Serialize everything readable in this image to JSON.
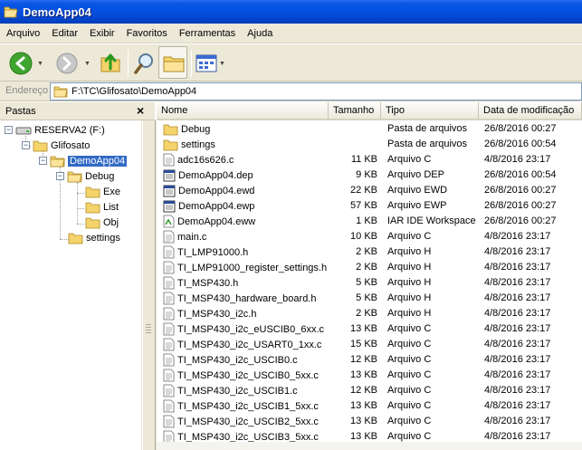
{
  "window": {
    "title": "DemoApp04"
  },
  "menu": [
    "Arquivo",
    "Editar",
    "Exibir",
    "Favoritos",
    "Ferramentas",
    "Ajuda"
  ],
  "address": {
    "label": "Endereço",
    "path": "F:\\TC\\Glifosato\\DemoApp04"
  },
  "folders_pane": {
    "title": "Pastas",
    "tree": [
      {
        "label": "RESERVA2 (F:)",
        "icon": "drive-icon"
      },
      {
        "label": "Glifosato",
        "icon": "folder-icon"
      },
      {
        "label": "DemoApp04",
        "icon": "folder-open-icon",
        "selected": true
      },
      {
        "label": "Debug",
        "icon": "folder-open-icon"
      },
      {
        "label": "Exe",
        "icon": "folder-icon"
      },
      {
        "label": "List",
        "icon": "folder-icon"
      },
      {
        "label": "Obj",
        "icon": "folder-icon"
      },
      {
        "label": "settings",
        "icon": "folder-icon"
      }
    ]
  },
  "columns": {
    "name": "Nome",
    "size": "Tamanho",
    "type": "Tipo",
    "date": "Data de modificação"
  },
  "files": [
    {
      "name": "Debug",
      "size": "",
      "type": "Pasta de arquivos",
      "date": "26/8/2016 00:27",
      "icon": "folder-icon"
    },
    {
      "name": "settings",
      "size": "",
      "type": "Pasta de arquivos",
      "date": "26/8/2016 00:54",
      "icon": "folder-icon"
    },
    {
      "name": "adc16s626.c",
      "size": "11 KB",
      "type": "Arquivo C",
      "date": "4/8/2016 23:17",
      "icon": "document-icon"
    },
    {
      "name": "DemoApp04.dep",
      "size": "9 KB",
      "type": "Arquivo DEP",
      "date": "26/8/2016 00:54",
      "icon": "window-file-icon"
    },
    {
      "name": "DemoApp04.ewd",
      "size": "22 KB",
      "type": "Arquivo EWD",
      "date": "26/8/2016 00:27",
      "icon": "window-file-icon"
    },
    {
      "name": "DemoApp04.ewp",
      "size": "57 KB",
      "type": "Arquivo EWP",
      "date": "26/8/2016 00:27",
      "icon": "window-file-icon"
    },
    {
      "name": "DemoApp04.eww",
      "size": "1 KB",
      "type": "IAR IDE Workspace",
      "date": "26/8/2016 00:27",
      "icon": "workspace-icon"
    },
    {
      "name": "main.c",
      "size": "10 KB",
      "type": "Arquivo C",
      "date": "4/8/2016 23:17",
      "icon": "document-icon"
    },
    {
      "name": "TI_LMP91000.h",
      "size": "2 KB",
      "type": "Arquivo H",
      "date": "4/8/2016 23:17",
      "icon": "document-icon"
    },
    {
      "name": "TI_LMP91000_register_settings.h",
      "size": "2 KB",
      "type": "Arquivo H",
      "date": "4/8/2016 23:17",
      "icon": "document-icon"
    },
    {
      "name": "TI_MSP430.h",
      "size": "5 KB",
      "type": "Arquivo H",
      "date": "4/8/2016 23:17",
      "icon": "document-icon"
    },
    {
      "name": "TI_MSP430_hardware_board.h",
      "size": "5 KB",
      "type": "Arquivo H",
      "date": "4/8/2016 23:17",
      "icon": "document-icon"
    },
    {
      "name": "TI_MSP430_i2c.h",
      "size": "2 KB",
      "type": "Arquivo H",
      "date": "4/8/2016 23:17",
      "icon": "document-icon"
    },
    {
      "name": "TI_MSP430_i2c_eUSCIB0_6xx.c",
      "size": "13 KB",
      "type": "Arquivo C",
      "date": "4/8/2016 23:17",
      "icon": "document-icon"
    },
    {
      "name": "TI_MSP430_i2c_USART0_1xx.c",
      "size": "15 KB",
      "type": "Arquivo C",
      "date": "4/8/2016 23:17",
      "icon": "document-icon"
    },
    {
      "name": "TI_MSP430_i2c_USCIB0.c",
      "size": "12 KB",
      "type": "Arquivo C",
      "date": "4/8/2016 23:17",
      "icon": "document-icon"
    },
    {
      "name": "TI_MSP430_i2c_USCIB0_5xx.c",
      "size": "13 KB",
      "type": "Arquivo C",
      "date": "4/8/2016 23:17",
      "icon": "document-icon"
    },
    {
      "name": "TI_MSP430_i2c_USCIB1.c",
      "size": "12 KB",
      "type": "Arquivo C",
      "date": "4/8/2016 23:17",
      "icon": "document-icon"
    },
    {
      "name": "TI_MSP430_i2c_USCIB1_5xx.c",
      "size": "13 KB",
      "type": "Arquivo C",
      "date": "4/8/2016 23:17",
      "icon": "document-icon"
    },
    {
      "name": "TI_MSP430_i2c_USCIB2_5xx.c",
      "size": "13 KB",
      "type": "Arquivo C",
      "date": "4/8/2016 23:17",
      "icon": "document-icon"
    },
    {
      "name": "TI_MSP430_i2c_USCIB3_5xx.c",
      "size": "13 KB",
      "type": "Arquivo C",
      "date": "4/8/2016 23:17",
      "icon": "document-icon"
    }
  ],
  "colors": {
    "titlebar": "#0550de",
    "selection": "#316ac5",
    "chrome": "#ece9d8"
  }
}
